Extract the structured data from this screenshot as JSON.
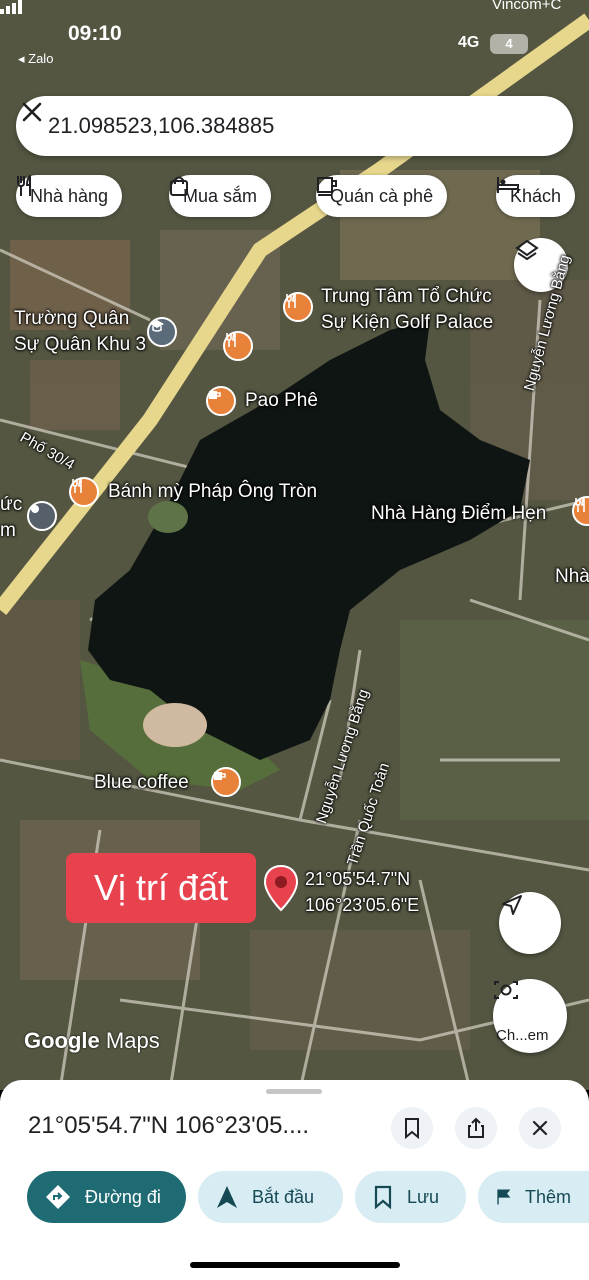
{
  "status_bar": {
    "time": "09:10",
    "back_app": "◂ Zalo",
    "network": "4G",
    "battery": "4",
    "top_right_label": "Vincom+C"
  },
  "search": {
    "query": "21.098523,106.384885"
  },
  "chips": [
    {
      "label": "Nhà hàng",
      "icon": "fork-knife-icon"
    },
    {
      "label": "Mua sắm",
      "icon": "shopping-bag-icon"
    },
    {
      "label": "Quán cà phê",
      "icon": "coffee-cup-icon"
    },
    {
      "label": "Khách",
      "icon": "bed-icon"
    }
  ],
  "map_labels": {
    "golf_palace_1": "Trung Tâm Tổ Chức",
    "golf_palace_2": "Sự Kiện Golf Palace",
    "truong_quan_su_1": "Trường Quân",
    "truong_quan_su_2": "Sự Quân Khu 3",
    "pao_phe": "Pao Phê",
    "pho_30_4": "Phố 30/4",
    "banh_my": "Bánh mỳ Pháp Ông Tròn",
    "nha_hang_diem_hen": "Nhà Hàng Điểm Hẹn",
    "nha_cut": "Nhà",
    "left_cut_1": "ức",
    "left_cut_2": "m",
    "nguyen_luong_bang_top": "Nguyễn Lương Bằng",
    "nguyen_luong_bang": "Nguyễn Lương Bằng",
    "tran_quoc_toan": "Trần Quốc Toản",
    "blue_coffee": "Blue coffee",
    "pin_lat": "21°05'54.7\"N",
    "pin_lng": "106°23'05.6\"E",
    "badge": "Vị trí đất"
  },
  "map_footer": {
    "google": "Google",
    "maps": "Maps",
    "camera_label": "Ch...em"
  },
  "sheet": {
    "title": "21°05'54.7\"N 106°23'05....",
    "actions": [
      {
        "label": "Đường đi",
        "icon": "directions-icon"
      },
      {
        "label": "Bắt đầu",
        "icon": "navigation-arrow-icon"
      },
      {
        "label": "Lưu",
        "icon": "bookmark-icon"
      },
      {
        "label": "Thêm",
        "icon": "flag-icon"
      }
    ]
  },
  "colors": {
    "primary_action": "#1f6b74",
    "secondary_action": "#d7ecf3",
    "badge": "#e8424f",
    "poi": "#e8823a",
    "pin": "#e8424f"
  }
}
